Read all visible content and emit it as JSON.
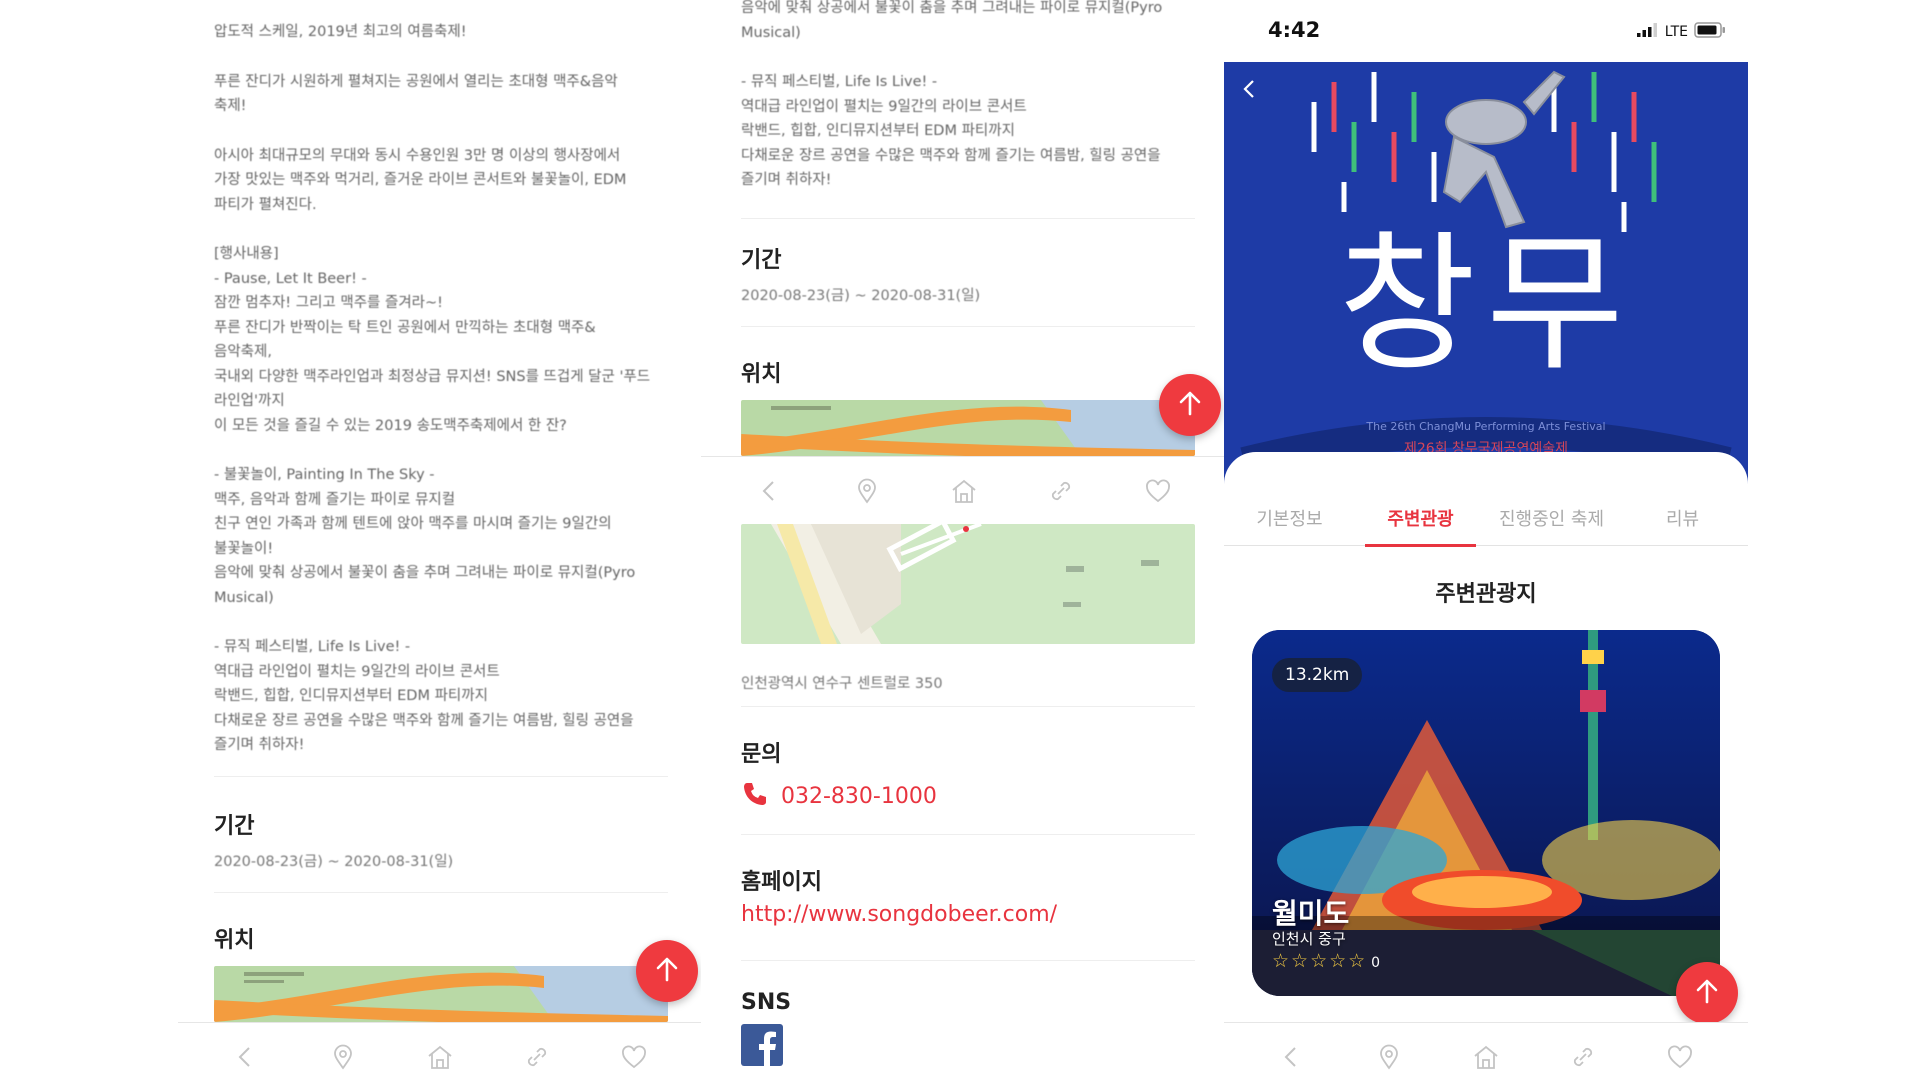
{
  "panel1": {
    "paragraphs": [
      [
        "압도적 스케일, 2019년 최고의 여름축제!"
      ],
      [
        "푸른 잔디가 시원하게 펼쳐지는 공원에서 열리는 초대형 맥주&음악",
        "축제!"
      ],
      [
        "아시아 최대규모의 무대와 동시 수용인원 3만 명 이상의 행사장에서",
        "가장 맛있는 맥주와 먹거리, 즐거운 라이브 콘서트와 불꽃놀이, EDM",
        "파티가 펼쳐진다."
      ],
      [
        "[행사내용]",
        "- Pause, Let It Beer! -",
        "잠깐 멈추자! 그리고 맥주를 즐겨라~!",
        "푸른 잔디가 반짝이는 탁 트인 공원에서 만끽하는 초대형 맥주&",
        "음악축제,",
        "국내외 다양한 맥주라인업과 최정상급 뮤지션! SNS를 뜨겁게 달군 '푸드",
        "라인업'까지",
        "이 모든 것을 즐길 수 있는 2019 송도맥주축제에서 한 잔?"
      ],
      [
        "- 불꽃놀이, Painting In The Sky -",
        "맥주, 음악과 함께 즐기는 파이로 뮤지컬",
        "친구 연인 가족과 함께 텐트에 앉아 맥주를 마시며 즐기는 9일간의",
        "불꽃놀이!",
        "음악에 맞춰 상공에서 불꽃이 춤을 추며 그려내는 파이로 뮤지컬(Pyro",
        "Musical)"
      ],
      [
        "- 뮤직 페스티벌, Life Is Live! -",
        "역대급 라인업이 펼치는 9일간의 라이브 콘서트",
        "락밴드, 힙합, 인디뮤지션부터 EDM 파티까지",
        "다채로운 장르 공연을 수많은 맥주와 함께 즐기는 여름밤, 힐링 공연을",
        "즐기며 취하자!"
      ]
    ],
    "period_title": "기간",
    "period_value": "2020-08-23(금) ~ 2020-08-31(일)",
    "location_title": "위치"
  },
  "panel2": {
    "top_lines": [
      "음악에 맞춰 상공에서 불꽃이 춤을 추며 그려내는 파이로 뮤지컬(Pyro",
      "Musical)"
    ],
    "music_lines": [
      "- 뮤직 페스티벌, Life Is Live! -",
      "역대급 라인업이 펼치는 9일간의 라이브 콘서트",
      "락밴드, 힙합, 인디뮤지션부터 EDM 파티까지",
      "다채로운 장르 공연을 수많은 맥주와 함께 즐기는 여름밤, 힐링 공연을",
      "즐기며 취하자!"
    ],
    "period_title": "기간",
    "period_value": "2020-08-23(금) ~ 2020-08-31(일)",
    "location_title": "위치",
    "address": "인천광역시 연수구 센트럴로 350",
    "inquiry_title": "문의",
    "phone": "032-830-1000",
    "homepage_title": "홈페이지",
    "homepage_url": "http://www.songdobeer.com/",
    "sns_title": "SNS"
  },
  "panel3": {
    "status_time": "4:42",
    "status_network": "LTE",
    "poster_title": "창무",
    "poster_subtitle": "The 26th ChangMu Performing Arts Festival",
    "poster_subtitle_kr": "제26회 창무국제공연예술제",
    "tabs": [
      "기본정보",
      "주변관광",
      "진행중인 축제",
      "리뷰"
    ],
    "section_heading": "주변관광지",
    "card": {
      "distance": "13.2km",
      "name": "월미도",
      "region": "인천시 중구",
      "rating_stars": "☆☆☆☆☆",
      "rating_count": "0"
    }
  },
  "colors": {
    "accent": "#e8343f",
    "fab": "#ef3a3f",
    "poster_blue": "#1e3ba6",
    "facebook": "#3b5998"
  },
  "icons": {
    "nav": [
      "back-icon",
      "location-pin-icon",
      "home-icon",
      "link-icon",
      "heart-icon"
    ],
    "fab": "arrow-up-icon"
  }
}
